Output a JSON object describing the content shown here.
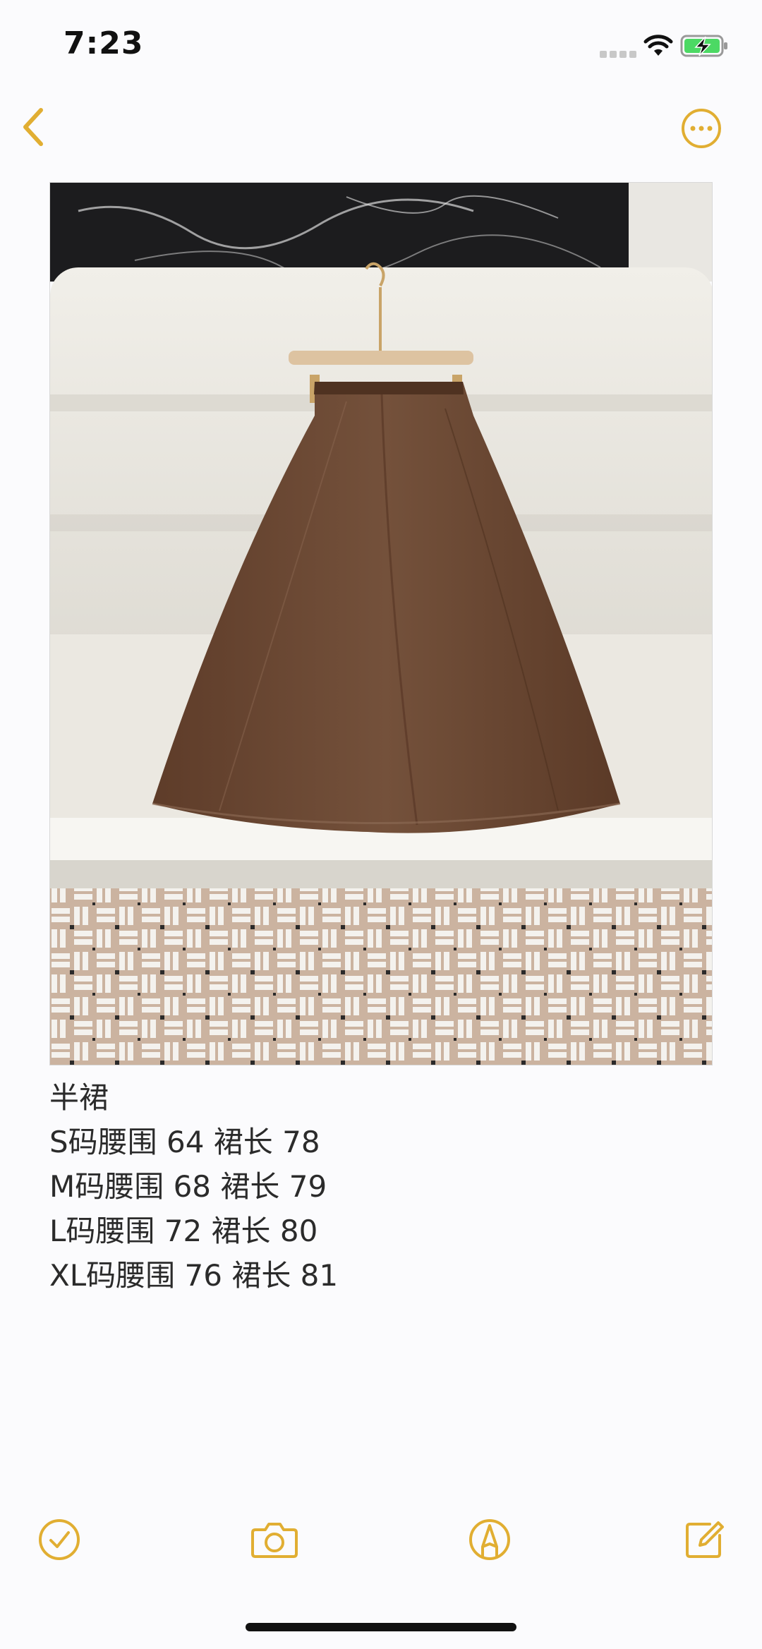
{
  "status_bar": {
    "time": "7:23"
  },
  "nav": {
    "back_icon": "chevron-left-icon",
    "more_icon": "ellipsis-circle-icon"
  },
  "note": {
    "lines": [
      "半裙",
      "S码腰围 64 裙长 78",
      "M码腰围 68 裙长 79",
      "L码腰围 72 裙长 80",
      "XL码腰围 76 裙长 81"
    ]
  },
  "toolbar": {
    "checklist_icon": "checkmark-circle-icon",
    "camera_icon": "camera-icon",
    "markup_icon": "pen-circle-icon",
    "compose_icon": "compose-icon"
  },
  "colors": {
    "accent": "#E1AE32",
    "skirt": "#6b4632",
    "background": "#fbfbfd",
    "text": "#2b2b2b"
  }
}
